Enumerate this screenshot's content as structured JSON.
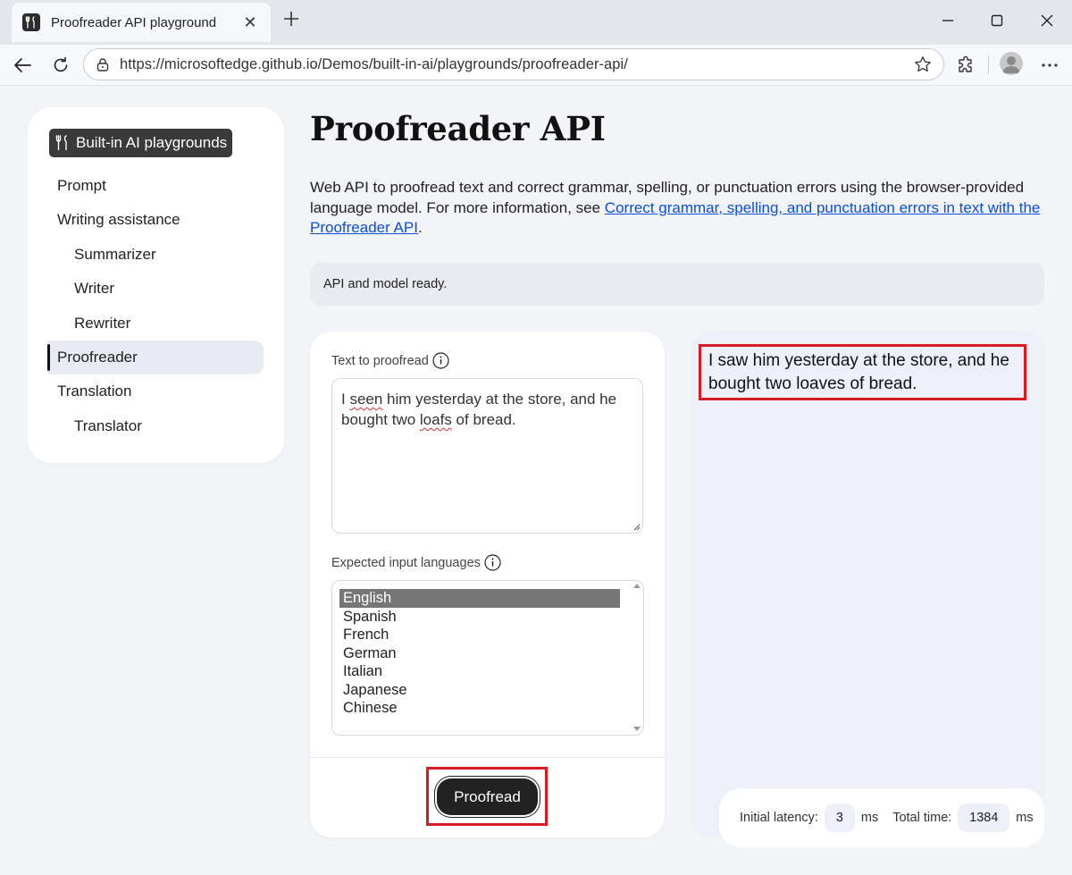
{
  "browser": {
    "tab_title": "Proofreader API playground",
    "url": "https://microsoftedge.github.io/Demos/built-in-ai/playgrounds/proofreader-api/"
  },
  "sidebar": {
    "brand": "Built-in AI playgrounds",
    "items": [
      {
        "label": "Prompt",
        "level": 0,
        "active": false
      },
      {
        "label": "Writing assistance",
        "level": 0,
        "active": false
      },
      {
        "label": "Summarizer",
        "level": 1,
        "active": false
      },
      {
        "label": "Writer",
        "level": 1,
        "active": false
      },
      {
        "label": "Rewriter",
        "level": 1,
        "active": false
      },
      {
        "label": "Proofreader",
        "level": 0,
        "active": true
      },
      {
        "label": "Translation",
        "level": 0,
        "active": false
      },
      {
        "label": "Translator",
        "level": 1,
        "active": false
      }
    ]
  },
  "main": {
    "title": "Proofreader API",
    "description_prefix": "Web API to proofread text and correct grammar, spelling, or punctuation errors using the browser-provided language model. For more information, see ",
    "description_link": "Correct grammar, spelling, and punctuation errors in text with the Proofreader API",
    "description_suffix": ".",
    "status": "API and model ready."
  },
  "form": {
    "text_label": "Text to proofread",
    "text_value_parts": [
      "I ",
      "seen",
      " him yesterday at the store, and he bought two ",
      "loafs",
      " of bread."
    ],
    "languages_label": "Expected input languages",
    "languages": [
      "English",
      "Spanish",
      "French",
      "German",
      "Italian",
      "Japanese",
      "Chinese"
    ],
    "selected_language": "English",
    "button_label": "Proofread"
  },
  "output": {
    "text": "I saw him yesterday at the store, and he bought two loaves of bread."
  },
  "metrics": {
    "initial_latency_label": "Initial latency:",
    "initial_latency_value": "3",
    "total_time_label": "Total time:",
    "total_time_value": "1384",
    "unit": "ms"
  },
  "colors": {
    "highlight_red": "#d81b23",
    "link_blue": "#0b4fd8",
    "selected_option": "#767676"
  }
}
